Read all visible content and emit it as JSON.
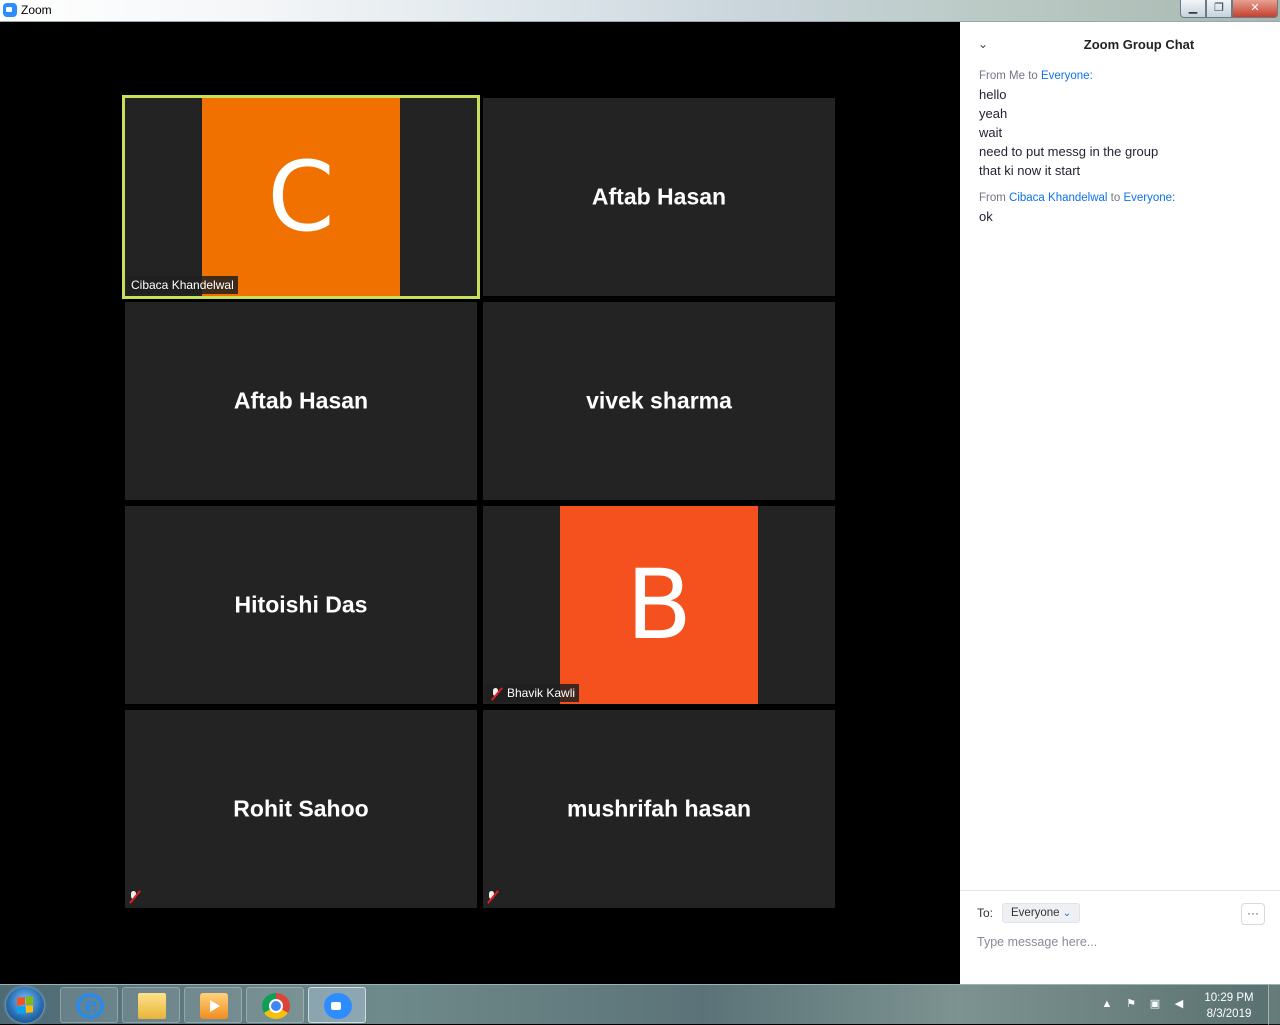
{
  "window": {
    "title": "Zoom"
  },
  "gallery": {
    "tiles": [
      {
        "name": "Cibaca Khandelwal",
        "avatar_letter": "C",
        "avatar_color": "#f07000",
        "active": true
      },
      {
        "name": "Aftab Hasan"
      },
      {
        "name": "Aftab Hasan"
      },
      {
        "name": "vivek sharma"
      },
      {
        "name": "Hitoishi Das"
      },
      {
        "name": "Bhavik Kawli",
        "avatar_letter": "B",
        "avatar_color": "#f4511e",
        "muted": true
      },
      {
        "name": "Rohit Sahoo",
        "muted": true
      },
      {
        "name": "mushrifah hasan",
        "muted": true
      }
    ]
  },
  "chat": {
    "title": "Zoom Group Chat",
    "groups": [
      {
        "from_prefix": "From Me to ",
        "to": "Everyone:",
        "lines": [
          "hello",
          "yeah",
          "wait",
          "need to put messg in the group",
          "that ki now it start"
        ]
      },
      {
        "from_prefix": "From ",
        "sender": "Cibaca Khandelwal",
        "to_prefix": " to ",
        "to": "Everyone:",
        "lines": [
          "ok"
        ]
      }
    ],
    "to_label": "To:",
    "to_value": "Everyone",
    "more_label": "···",
    "input_placeholder": "Type message here..."
  },
  "taskbar": {
    "time": "10:29 PM",
    "date": "8/3/2019"
  },
  "colors": {
    "active_tile_border": "#c6e05b",
    "chat_link": "#0e71eb"
  }
}
